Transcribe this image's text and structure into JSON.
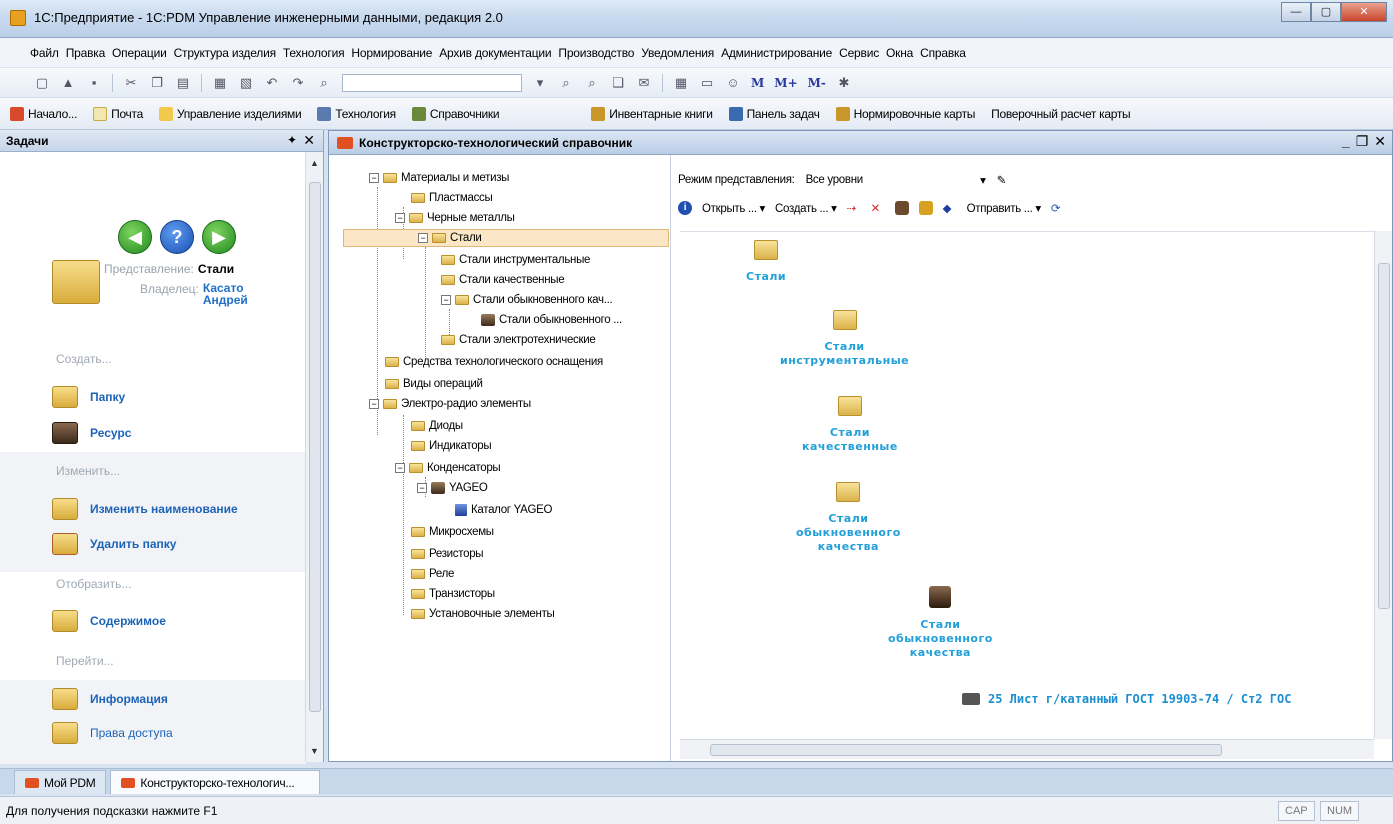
{
  "window": {
    "title": "1С:Предприятие - 1С:PDM Управление инженерными данными, редакция 2.0"
  },
  "menu": [
    "Файл",
    "Правка",
    "Операции",
    "Структура изделия",
    "Технология",
    "Нормирование",
    "Архив документации",
    "Производство",
    "Уведомления",
    "Администрирование",
    "Сервис",
    "Окна",
    "Справка"
  ],
  "toolbar": {
    "m1": "M",
    "m2": "M+",
    "m3": "M-"
  },
  "quick_panel": {
    "items": [
      "Начало...",
      "Почта",
      "Управление изделиями",
      "Технология",
      "Справочники",
      "Инвентарные книги",
      "Панель задач",
      "Нормировочные карты",
      "Поверочный расчет карты"
    ]
  },
  "tasks_pane": {
    "title": "Задачи",
    "representation_label": "Представление:",
    "representation_value": "Стали",
    "owner_label": "Владелец:",
    "owner_value": "Касато\nАндрей",
    "sections": {
      "create": "Создать...",
      "change": "Изменить...",
      "show": "Отобразить...",
      "goto": "Перейти..."
    },
    "actions": {
      "folder": "Папку",
      "resource": "Ресурс",
      "rename": "Изменить наименование",
      "delete_folder": "Удалить папку",
      "contents": "Содержимое",
      "info": "Информация",
      "access": "Права доступа"
    }
  },
  "main_window": {
    "title": "Конструкторско-технологический справочник"
  },
  "tree": {
    "nodes": {
      "materials": "Материалы и метизы",
      "plastics": "Пластмассы",
      "ferrous": "Черные металлы",
      "steels": "Стали",
      "tool_steels": "Стали инструментальные",
      "quality_steels": "Стали качественные",
      "ordinary_steels": "Стали обыкновенного кач...",
      "ordinary_steels_res": "Стали обыкновенного ...",
      "electrotech_steels": "Стали электротехнические",
      "tech_equipment": "Средства технологического оснащения",
      "operation_types": "Виды операций",
      "electro_radio": "Электро-радио элементы",
      "diodes": "Диоды",
      "indicators": "Индикаторы",
      "capacitors": "Конденсаторы",
      "yageo": "YAGEO",
      "yageo_catalog": "Каталог YAGEO",
      "microchips": "Микросхемы",
      "resistors": "Резисторы",
      "relays": "Реле",
      "transistors": "Транзисторы",
      "mounting": "Установочные элементы"
    }
  },
  "right_pane": {
    "mode_label": "Режим представления:",
    "mode_value": "Все уровни",
    "open_label": "Открыть ...",
    "create_label": "Создать ...",
    "send_label": "Отправить ...",
    "items": {
      "steels": "Стали",
      "tool_steels": "Стали\nинструментальные",
      "quality_steels": "Стали\nкачественные",
      "ordinary_folder": "Стали\nобыкновенного\nкачества",
      "ordinary_res": "Стали\nобыкновенного\nкачества",
      "list_item": "25 Лист г/катанный ГОСТ 19903-74 / Ст2 ГОС"
    }
  },
  "window_tabs": [
    "Мой PDM",
    "Конструкторско-технологич..."
  ],
  "status": {
    "hint": "Для получения подсказки нажмите F1",
    "cap": "CAP",
    "num": "NUM"
  }
}
